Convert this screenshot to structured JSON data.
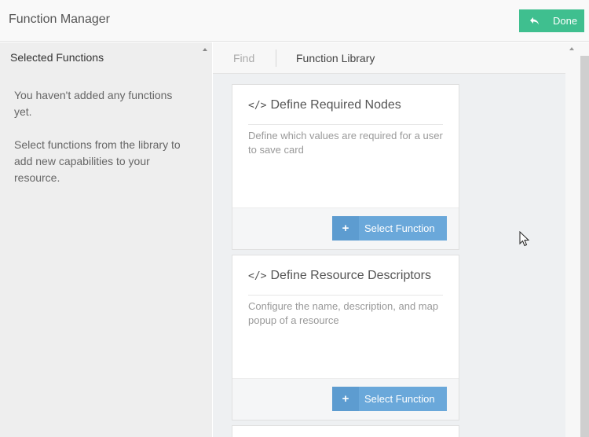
{
  "header": {
    "title": "Function Manager",
    "done_label": "Done"
  },
  "left_panel": {
    "title": "Selected Functions",
    "empty_message_1": "You haven't added any functions yet.",
    "empty_message_2": "Select functions from the library to add new capabilities to your resource."
  },
  "tabs": {
    "find": "Find",
    "library": "Function Library",
    "active": "Function Library"
  },
  "library": {
    "cards": [
      {
        "title": "Define Required Nodes",
        "description": "Define which values are required for a user to save card",
        "button_label": "Select Function"
      },
      {
        "title": "Define Resource Descriptors",
        "description": "Configure the name, description, and map popup of a resource",
        "button_label": "Select Function"
      }
    ]
  },
  "colors": {
    "done_button": "#3fbf8f",
    "select_button": "#6aa8da",
    "library_background": "#eef0f2"
  },
  "icons": {
    "done": "undo-arrow-icon",
    "card": "code-icon",
    "select": "plus-icon"
  }
}
